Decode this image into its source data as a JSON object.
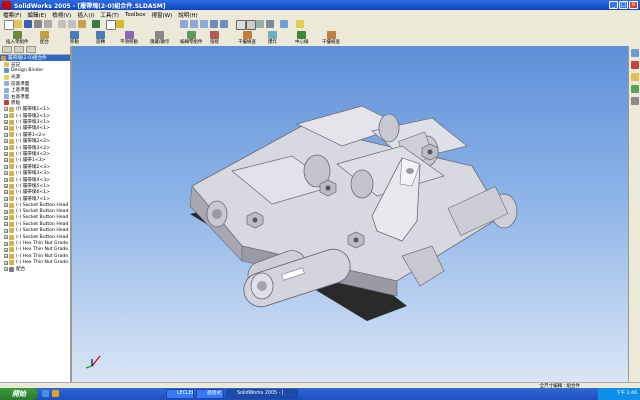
{
  "window": {
    "title": "SolidWorks 2005 - [履帶塊(2-0)組合件.SLDASM]",
    "controls": [
      "minimize-icon",
      "maximize-icon",
      "close-icon"
    ]
  },
  "menubar": {
    "items": [
      "檔案(F)",
      "編輯(E)",
      "檢視(V)",
      "插入(I)",
      "工具(T)",
      "Toolbox",
      "視窗(W)",
      "說明(H)"
    ]
  },
  "toolbar": {
    "commands": [
      {
        "label": "插入零組件",
        "icon": "insert-component-icon"
      },
      {
        "label": "配合",
        "icon": "mate-icon"
      },
      {
        "label": "移動",
        "icon": "move-icon"
      },
      {
        "label": "旋轉",
        "icon": "rotate-icon"
      },
      {
        "label": "平滑移動",
        "icon": "smart-move-icon"
      },
      {
        "label": "隱藏/顯示",
        "icon": "show-hide-icon"
      },
      {
        "label": "編輯零組件",
        "icon": "edit-component-icon"
      },
      {
        "label": "熔接",
        "icon": "weld-icon"
      },
      {
        "label": "干擾檢查",
        "icon": "interference-icon"
      },
      {
        "label": "爆炸",
        "icon": "explode-icon"
      },
      {
        "label": "中心線",
        "icon": "centerline-icon"
      },
      {
        "label": "干擾檢查",
        "icon": "interference2-icon"
      }
    ]
  },
  "feature_tree": {
    "items": [
      {
        "label": "履帶塊(2-0)組合件",
        "icon": "assembly-icon",
        "selected": true
      },
      {
        "label": "註記",
        "icon": "annotation-icon"
      },
      {
        "label": "Design Binder",
        "icon": "binder-icon"
      },
      {
        "label": "光源",
        "icon": "light-icon"
      },
      {
        "label": "前基準面",
        "icon": "plane-icon"
      },
      {
        "label": "上基準面",
        "icon": "plane-icon"
      },
      {
        "label": "右基準面",
        "icon": "plane-icon"
      },
      {
        "label": "原點",
        "icon": "origin-icon"
      },
      {
        "label": "(f) 履帶塊1<1>",
        "icon": "part-icon"
      },
      {
        "label": "(-) 履帶塊2<1>",
        "icon": "part-icon"
      },
      {
        "label": "(-) 履帶塊3<1>",
        "icon": "part-icon"
      },
      {
        "label": "(-) 履帶塊4<1>",
        "icon": "part-icon"
      },
      {
        "label": "(-) 履帶1<2>",
        "icon": "part-icon"
      },
      {
        "label": "(-) 履帶塊2<2>",
        "icon": "part-icon"
      },
      {
        "label": "(-) 履帶塊3<2>",
        "icon": "part-icon"
      },
      {
        "label": "(-) 履帶塊4<2>",
        "icon": "part-icon"
      },
      {
        "label": "(-) 履帶1<3>",
        "icon": "part-icon"
      },
      {
        "label": "(-) 履帶塊2<3>",
        "icon": "part-icon"
      },
      {
        "label": "(-) 履帶塊3<3>",
        "icon": "part-icon"
      },
      {
        "label": "(-) 履帶塊4<3>",
        "icon": "part-icon"
      },
      {
        "label": "(-) 履帶塊5<1>",
        "icon": "part-icon"
      },
      {
        "label": "(-) 履帶塊6<1>",
        "icon": "part-icon"
      },
      {
        "label": "(-) 履帶塊7<1>",
        "icon": "part-icon"
      },
      {
        "label": "(-) Socket Button Head Screw...",
        "icon": "part-icon"
      },
      {
        "label": "(-) Socket Button Head Screw...",
        "icon": "part-icon"
      },
      {
        "label": "(-) Socket Button Head Screw...",
        "icon": "part-icon"
      },
      {
        "label": "(-) Socket Button Head Screw...",
        "icon": "part-icon"
      },
      {
        "label": "(-) Socket Button Head Screw...",
        "icon": "part-icon"
      },
      {
        "label": "(-) Socket Button Head Screw...",
        "icon": "part-icon"
      },
      {
        "label": "(-) Hex Thin Nut Grade...",
        "icon": "part-icon"
      },
      {
        "label": "(-) Hex Thin Nut Grade...",
        "icon": "part-icon"
      },
      {
        "label": "(-) Hex Thin Nut Grade...",
        "icon": "part-icon"
      },
      {
        "label": "(-) Hex Thin Nut Grade...",
        "icon": "part-icon"
      },
      {
        "label": "配合",
        "icon": "mates-icon"
      }
    ]
  },
  "status_bar": {
    "text": "全尺寸編輯 : 組合件"
  },
  "taskbar": {
    "start_label": "開始",
    "tasks": [
      {
        "label": "LECLERC",
        "active": false
      },
      {
        "label": "進程式",
        "active": false
      },
      {
        "label": "SolidWorks 2005 - [",
        "active": true
      }
    ],
    "clock": "下午 1:46"
  },
  "colors": {
    "viewport_top": "#5e90d8",
    "viewport_bottom": "#d9e6f5",
    "part_main": "#d8d8e0",
    "part_shadow": "#8e8e99",
    "part_dark": "#2a2a2a",
    "selected_row": "#316ac5"
  }
}
